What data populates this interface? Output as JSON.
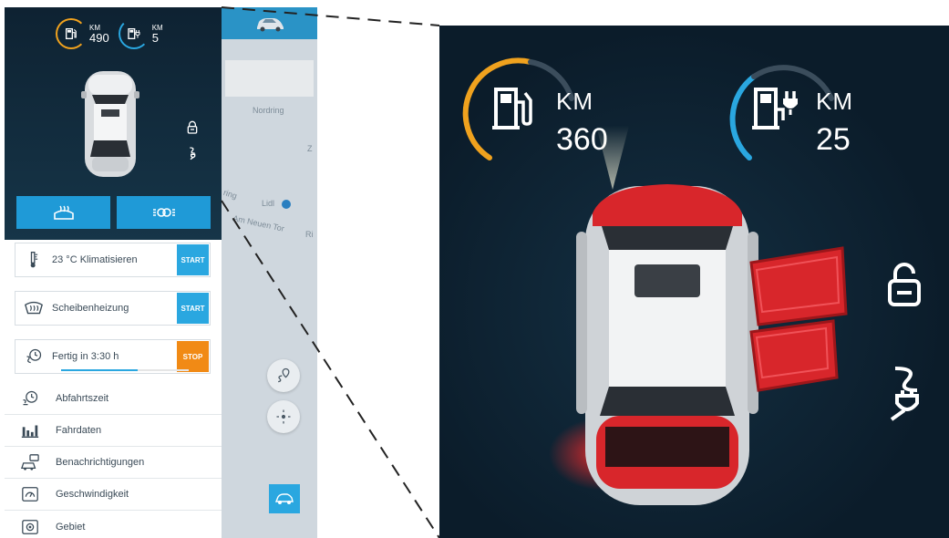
{
  "colors": {
    "fuel_accent": "#f0a21e",
    "electric_accent": "#2aa7e0",
    "button_blue": "#2aa7e0",
    "stop_orange": "#f18a15",
    "dark_panel": "#0e2232"
  },
  "small_range": {
    "fuel": {
      "unit": "KM",
      "value": "490",
      "icon": "fuel-pump-icon"
    },
    "electric": {
      "unit": "KM",
      "value": "5",
      "icon": "charging-station-icon"
    }
  },
  "big_range": {
    "fuel": {
      "unit": "KM",
      "value": "360",
      "icon": "fuel-pump-icon"
    },
    "electric": {
      "unit": "KM",
      "value": "25",
      "icon": "charging-station-icon"
    }
  },
  "status_icons": [
    "lock-icon",
    "charging-plug-icon"
  ],
  "action_buttons": [
    {
      "label": "",
      "icon": "heat-defrost-icon"
    },
    {
      "label": "",
      "icon": "lights-icon"
    }
  ],
  "cards": [
    {
      "text": "23 °C Klimatisieren",
      "button": "START",
      "icon": "thermometer-icon"
    },
    {
      "text": "Scheibenheizung",
      "button": "START",
      "icon": "windshield-heating-icon"
    },
    {
      "text": "Fertig in 3:30 h",
      "button": "STOP",
      "icon": "charging-timer-icon",
      "progress": 0.6
    }
  ],
  "menu": [
    {
      "text": "Abfahrtszeit",
      "icon": "departure-timer-icon"
    },
    {
      "text": "Fahrdaten",
      "icon": "bar-chart-icon"
    },
    {
      "text": "Benachrichtigungen",
      "icon": "notifications-icon"
    },
    {
      "text": "Geschwindigkeit",
      "icon": "speed-icon"
    },
    {
      "text": "Gebiet",
      "icon": "area-icon"
    }
  ],
  "map": {
    "labels": [
      "Nordring",
      "Lidl",
      "Am Neuen Tor",
      "Ri",
      "Z",
      "ring"
    ]
  }
}
